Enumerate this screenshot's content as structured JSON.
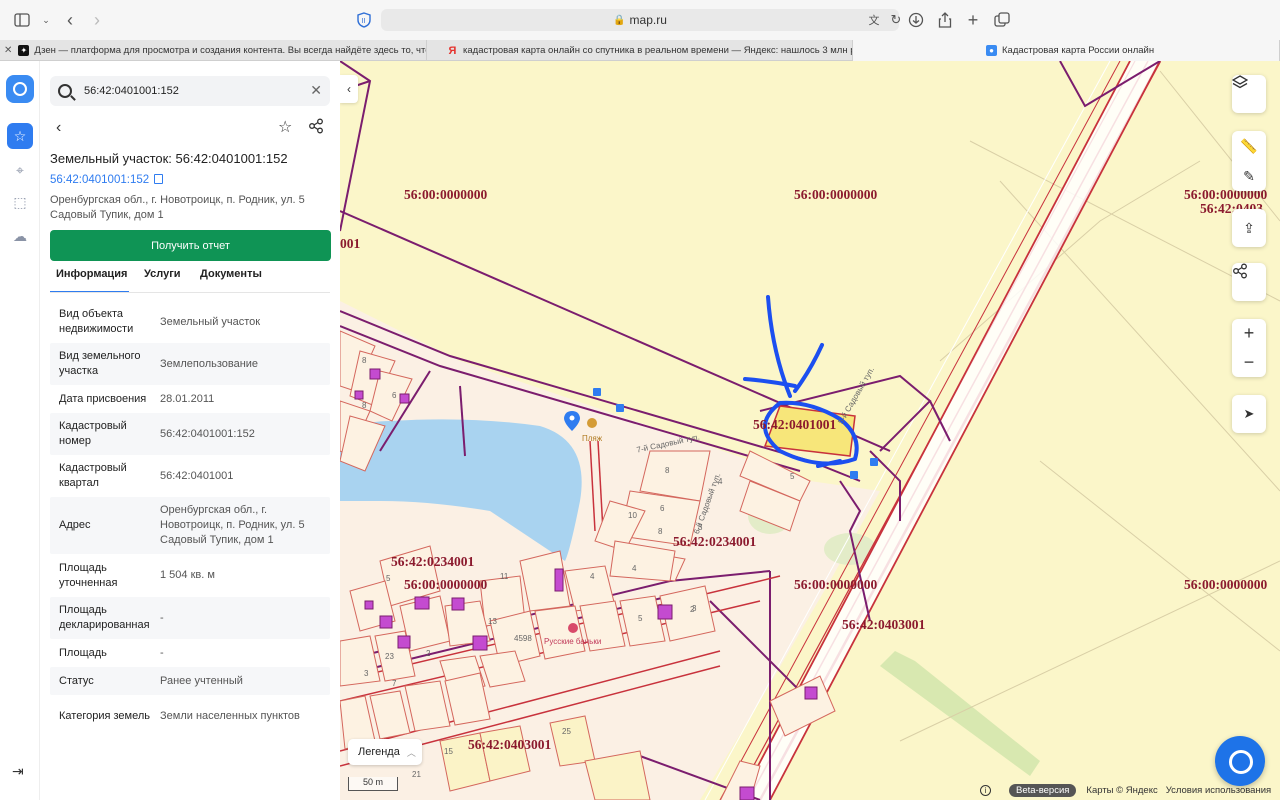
{
  "browser": {
    "url": "map.ru",
    "tabs": [
      {
        "title": "Дзен — платформа для просмотра и создания контента. Вы всегда найдёте здесь то, что..."
      },
      {
        "title": "кадастровая карта онлайн со спутника в реальном времени — Яндекс: нашлось 3 млн ре..."
      },
      {
        "title": "Кадастровая карта России онлайн"
      }
    ]
  },
  "search": {
    "value": "56:42:0401001:152"
  },
  "object": {
    "title": "Земельный участок: 56:42:0401001:152",
    "cad_number": "56:42:0401001:152",
    "address": "Оренбургская обл., г. Новотроицк, п. Родник, ул. 5 Садовый Тупик, дом 1",
    "report_button": "Получить отчет"
  },
  "panel_tabs": [
    "Информация",
    "Услуги",
    "Документы"
  ],
  "properties": [
    {
      "k": "Вид объекта недвижимости",
      "v": "Земельный участок"
    },
    {
      "k": "Вид земельного участка",
      "v": "Землепользование"
    },
    {
      "k": "Дата присвоения",
      "v": "28.01.2011"
    },
    {
      "k": "Кадастровый номер",
      "v": "56:42:0401001:152"
    },
    {
      "k": "Кадастровый квартал",
      "v": "56:42:0401001"
    },
    {
      "k": "Адрес",
      "v": "Оренбургская обл., г. Новотроицк, п. Родник, ул. 5 Садовый Тупик, дом 1"
    },
    {
      "k": "Площадь уточненная",
      "v": "1 504 кв. м"
    },
    {
      "k": "Площадь декларированная",
      "v": "-"
    },
    {
      "k": "Площадь",
      "v": "-"
    },
    {
      "k": "Статус",
      "v": "Ранее учтенный"
    },
    {
      "k": "Категория земель",
      "v": "Земли населенных пунктов"
    }
  ],
  "map": {
    "labels": [
      "56:00:0000000",
      "56:00:0000000",
      "56:00:0000000",
      "56:42:0403",
      "001",
      "56:42:0401001",
      "56:42:0234001",
      "56:42:0234001",
      "56:00:0000000",
      "56:00:0000000",
      "56:42:0403001",
      "56:00:0000000",
      "56:42:0403001"
    ],
    "pond_label": "Пляж",
    "street1": "7-й Садовый туп.",
    "street2": "6-й Садовый туп.",
    "street3": "5-й Садовый туп.",
    "banya": "Русские баньки",
    "legend": "Легенда",
    "scale": "50 m",
    "beta": "Beta-версия",
    "credits": "Карты © Яндекс",
    "terms": "Условия использования",
    "parcel_numbers": [
      "8",
      "8",
      "6",
      "5",
      "4",
      "3",
      "8",
      "4",
      "10",
      "8",
      "6",
      "5",
      "4",
      "2",
      "5",
      "4598",
      "2",
      "3",
      "7",
      "15",
      "21",
      "25",
      "23",
      "11",
      "13",
      "3"
    ]
  },
  "colors": {
    "accent": "#2f7cf0",
    "report": "#0f9455",
    "boundary": "#8b1a2e",
    "map_bg": "#fbf6c9",
    "water": "#a9d3f0"
  }
}
